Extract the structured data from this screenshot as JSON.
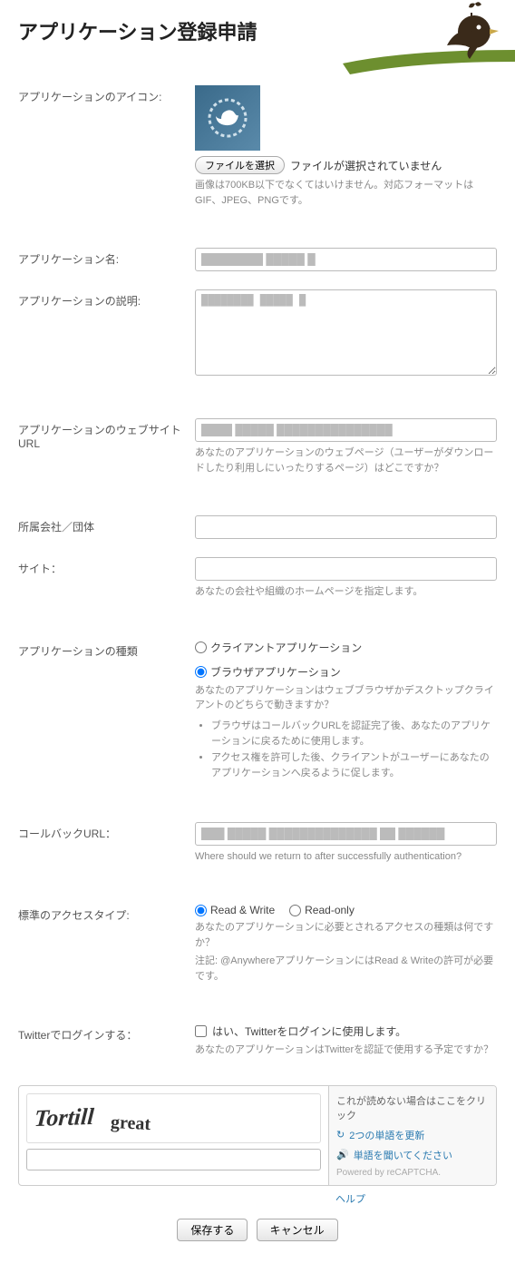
{
  "page": {
    "title": "アプリケーション登録申請"
  },
  "icon": {
    "label": "アプリケーションのアイコン:",
    "choose_btn": "ファイルを選択",
    "no_file": "ファイルが選択されていません",
    "helper": "画像は700KB以下でなくてはいけません。対応フォーマットはGIF、JPEG、PNGです。"
  },
  "name": {
    "label": "アプリケーション名:",
    "value": "████████ █████ █"
  },
  "desc": {
    "label": "アプリケーションの説明:",
    "value": "████████ █████ █"
  },
  "website": {
    "label": "アプリケーションのウェブサイトURL",
    "value": "████ █████ ███████████████",
    "helper": "あなたのアプリケーションのウェブページ（ユーザーがダウンロードしたり利用しにいったりするページ）はどこですか？"
  },
  "org": {
    "label": "所属会社／団体",
    "value": ""
  },
  "site": {
    "label": "サイト：",
    "value": "",
    "helper": "あなたの会社や組織のホームページを指定します。"
  },
  "type": {
    "label": "アプリケーションの種類",
    "opt_client": "クライアントアプリケーション",
    "opt_browser": "ブラウザアプリケーション",
    "helper": "あなたのアプリケーションはウェブブラウザかデスクトップクライアントのどちらで動きますか？",
    "bullet1": "ブラウザはコールバックURLを認証完了後、あなたのアプリケーションに戻るために使用します。",
    "bullet2": "アクセス権を許可した後、クライアントがユーザーにあなたのアプリケーションへ戻るように促します。"
  },
  "callback": {
    "label": "コールバックURL：",
    "value": "███ █████ ██████████████ ██ ██████",
    "helper": "Where should we return to after successfully authentication?"
  },
  "access": {
    "label": "標準のアクセスタイプ:",
    "opt_rw": "Read & Write",
    "opt_ro": "Read-only",
    "helper1": "あなたのアプリケーションに必要とされるアクセスの種類は何ですか？",
    "helper2": "注記: @AnywhereアプリケーションにはRead & Writeの許可が必要です。"
  },
  "login": {
    "label": "Twitterでログインする：",
    "checkbox_label": "はい、Twitterをログインに使用します。",
    "helper": "あなたのアプリケーションはTwitterを認証で使用する予定ですか？"
  },
  "captcha": {
    "word1": "Tortill",
    "word2": "great",
    "unreadable": "これが読めない場合はここをクリック",
    "refresh": "2つの単語を更新",
    "audio": "単語を聞いてください",
    "powered": "Powered by reCAPTCHA.",
    "help": "ヘルプ"
  },
  "buttons": {
    "save": "保存する",
    "cancel": "キャンセル"
  }
}
